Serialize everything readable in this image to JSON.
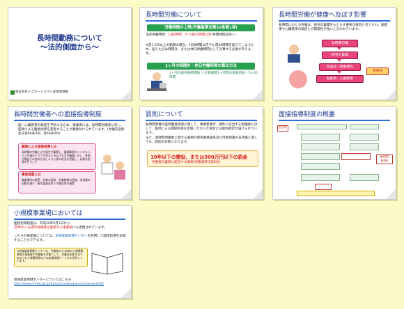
{
  "slides": [
    {
      "title": "長時間勤務について\n～法的側面から～",
      "footer": "株式会社ドクタートラスト産業保健部"
    },
    {
      "title": "長時間労働について",
      "bar": "労働時間の上限(労働基準法第32条第1項)",
      "line1_prefix": "法定労働時間：",
      "line1_red": "1日8時間、かつ週40時間以内",
      "line1_suffix": "(休憩時間は除く)",
      "note": "※週1.5日以上の勤務の場合、1日8時間以内でも週40時間を超えてしまうため、超えた分は時間外、または休日労働時間として計算する必要があります。",
      "bar2": "1ヶ月の時間外・休日労働時間の算出方法",
      "formula": "1ヶ月の総労働時間数－(計算期間1ヶ月間の総暦日数÷7)×40時間"
    },
    {
      "title": "長時間労働が健康へ及ぼす影響",
      "text": "長時間にわたる労働は、疲労の蓄積をもたらす重要な要因と考えられ、脳疾患や心臓疾患の発症との関連性が強いと言われています。",
      "steps": [
        "長時間労働",
        "疲労の蓄積",
        "高血圧・動脈硬化",
        "脳疾患、心臓疾患"
      ],
      "death": "過労死"
    },
    {
      "title": "長時間労働者への面接指導制度",
      "intro": "脳・心臓疾患の発症を予防するため、事業者には、長時間労働者に対し、医師による面接指導を実施することが義務付けられています。(労働安全衛生法第66条の8、第66条の9)",
      "box1_title": "義務による面接指導とは",
      "box1_text": "長時間の労働により疲労が蓄積し、健康障害やメンタルヘルス不調のリスクがあるとみなされる労働者に対し、医師が問診その他の方法により心身の状況を把握し、必要な指導を行うこと",
      "box2_title": "事後措置とは",
      "box2_text": "就業場所の変更、作業の転換、労働時間の短縮、深夜業の回数の減少、衛生委員会等への報告等の措置"
    },
    {
      "title": "罰則について",
      "text1": "長時間労働の医師面接指導に関して、事業者側が、要件に該当する労働者に対して、医師による面接指導を実施しなかった場合には罰則規定が設けられています。",
      "text2": "また、長時間労働者に関する書類の保存義務違反及び改善措置の未実施に関しても、罰則の対象となります。",
      "penalty": "10年以下の懲役、または300万円以下の罰金",
      "sub": "労働者の業務に起因する傷病(労働基準法第5条)"
    },
    {
      "title": "面接指導制度の概要",
      "left_label": "該当者",
      "right_label1": "面談要件",
      "right_label2": "管理医"
    },
    {
      "title": "小規模事業場においては",
      "text1": "面接指導制度は、平成20年4月1日から",
      "text1_red": "常時50人未満の労働者を使用する事業場",
      "text1_suffix": "にも適用されています。",
      "text2_prefix": "これらの事業場については、",
      "text2_link": "地域産業保健センター",
      "text2_suffix": "を利用して面接指導を実施することもできます。",
      "box": "※地域産業保健センターは、労働者50人未満の小規模事業場の事業者や労働者を対象として、労働安全衛生法で定められた保健指導などの産業保健サービスを提供しています。",
      "link_label": "地域産業保健センターについてはこちら",
      "url": "http://www.mhlw.go.jp/bunya/roudoukijun/anzeneisei02/"
    }
  ]
}
